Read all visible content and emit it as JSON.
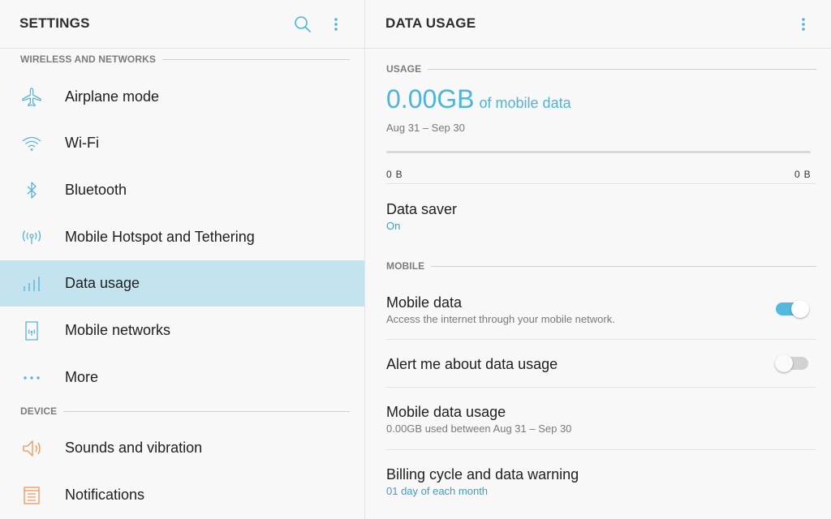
{
  "left": {
    "title": "SETTINGS",
    "sections": {
      "wireless": "WIRELESS AND NETWORKS",
      "device": "DEVICE"
    },
    "items": [
      {
        "label": "Airplane mode",
        "icon": "airplane-icon"
      },
      {
        "label": "Wi-Fi",
        "icon": "wifi-icon"
      },
      {
        "label": "Bluetooth",
        "icon": "bluetooth-icon"
      },
      {
        "label": "Mobile Hotspot and Tethering",
        "icon": "hotspot-icon"
      },
      {
        "label": "Data usage",
        "icon": "data-usage-icon",
        "selected": true
      },
      {
        "label": "Mobile networks",
        "icon": "mobile-networks-icon"
      },
      {
        "label": "More",
        "icon": "more-dots-icon"
      },
      {
        "label": "Sounds and vibration",
        "icon": "speaker-icon"
      },
      {
        "label": "Notifications",
        "icon": "notifications-icon"
      }
    ]
  },
  "right": {
    "title": "DATA USAGE",
    "usage_section": "USAGE",
    "usage_value": "0.00GB",
    "usage_unit": "of mobile data",
    "usage_range": "Aug 31 – Sep 30",
    "bar_left": "0 B",
    "bar_right": "0 B",
    "bar_fraction": 0,
    "data_saver": {
      "title": "Data saver",
      "value": "On"
    },
    "mobile_section": "MOBILE",
    "mobile_data": {
      "title": "Mobile data",
      "subtitle": "Access the internet through your mobile network.",
      "enabled": true
    },
    "alert": {
      "title": "Alert me about data usage",
      "enabled": false
    },
    "mobile_data_usage": {
      "title": "Mobile data usage",
      "subtitle": "0.00GB used between Aug 31 – Sep 30"
    },
    "billing": {
      "title": "Billing cycle and data warning",
      "subtitle": "01 day of each month"
    }
  },
  "colors": {
    "accent": "#4fb4d8",
    "selected_bg": "#c3e4ef",
    "icon_blue": "#58b3d8",
    "icon_orange": "#e9965a"
  }
}
